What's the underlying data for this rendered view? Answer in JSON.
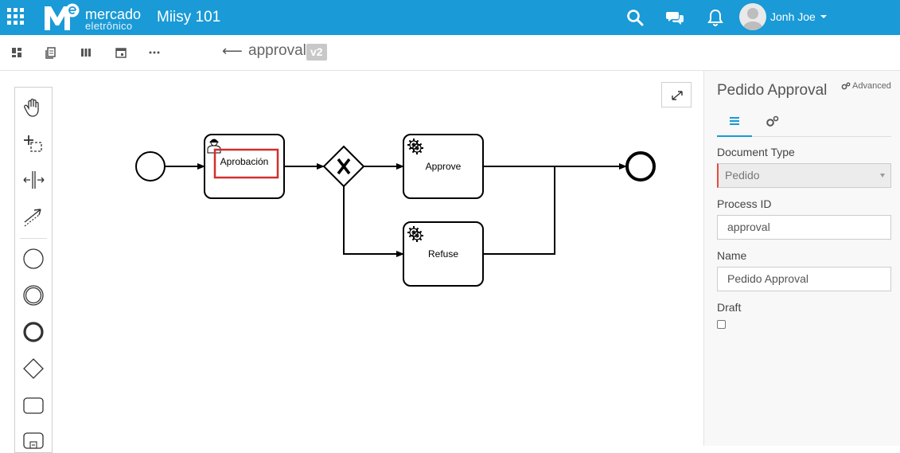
{
  "header": {
    "brand_line1": "mercado",
    "brand_line2": "eletrônico",
    "app_title": "Miisy 101",
    "user_name": "Jonh Joe"
  },
  "toolbar": {
    "process_name": "approval",
    "version_badge": "v2"
  },
  "diagram": {
    "tasks": [
      {
        "label": "Aprobación",
        "kind": "user-task"
      },
      {
        "label": "Approve",
        "kind": "service-task"
      },
      {
        "label": "Refuse",
        "kind": "service-task"
      }
    ]
  },
  "panel": {
    "title": "Pedido Approval",
    "advanced_label": "Advanced",
    "document_type_label": "Document Type",
    "document_type_value": "Pedido",
    "process_id_label": "Process ID",
    "process_id_value": "approval",
    "name_label": "Name",
    "name_value": "Pedido Approval",
    "draft_label": "Draft"
  },
  "colors": {
    "brand_blue": "#1a9ad6",
    "selection_red": "#d32f2f",
    "required_red": "#e74c3c"
  }
}
